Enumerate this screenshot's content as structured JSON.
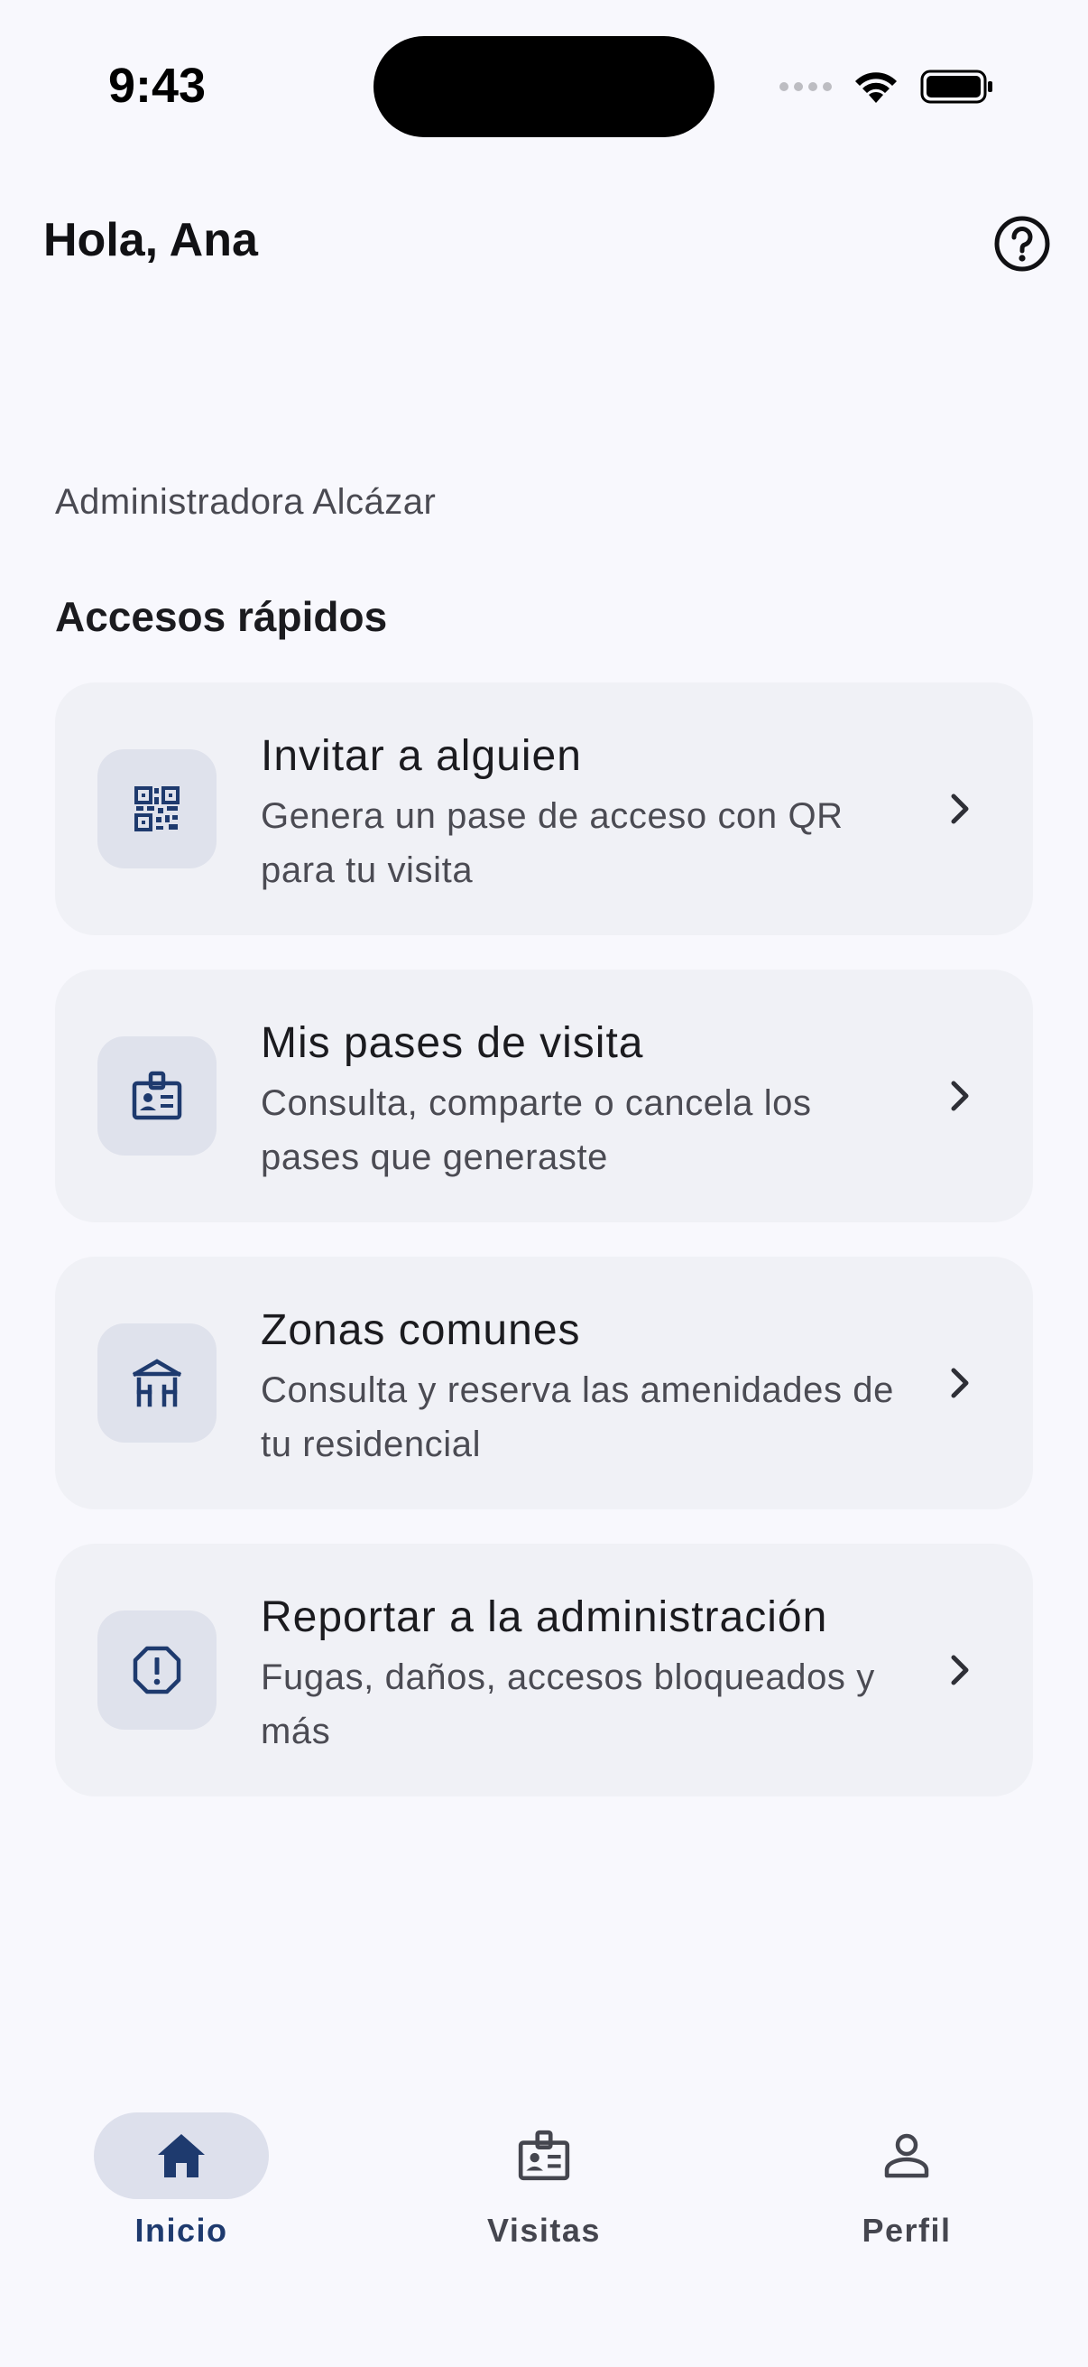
{
  "status_bar": {
    "time": "9:43"
  },
  "header": {
    "greeting": "Hola, Ana",
    "help_icon": "help-circle-icon"
  },
  "subtitle": "Administradora Alcázar",
  "section_title": "Accesos rápidos",
  "quick_access": [
    {
      "title": "Invitar a alguien",
      "description": "Genera un pase de acceso con QR para tu visita",
      "icon": "qr-code-icon"
    },
    {
      "title": "Mis pases de visita",
      "description": "Consulta, comparte o cancela los pases que generaste",
      "icon": "badge-icon"
    },
    {
      "title": "Zonas comunes",
      "description": "Consulta y reserva las amenidades de tu residencial",
      "icon": "gazebo-icon"
    },
    {
      "title": "Reportar a la administración",
      "description": "Fugas, daños, accesos bloqueados y más",
      "icon": "report-icon"
    }
  ],
  "nav": [
    {
      "label": "Inicio",
      "icon": "home-icon",
      "active": true
    },
    {
      "label": "Visitas",
      "icon": "badge-icon",
      "active": false
    },
    {
      "label": "Perfil",
      "icon": "person-icon",
      "active": false
    }
  ],
  "colors": {
    "background": "#F8F8FD",
    "card": "#F0F1F6",
    "icon_box": "#DFE2EC",
    "accent": "#1E3A6E",
    "nav_active_pill": "#DDE0EC"
  }
}
